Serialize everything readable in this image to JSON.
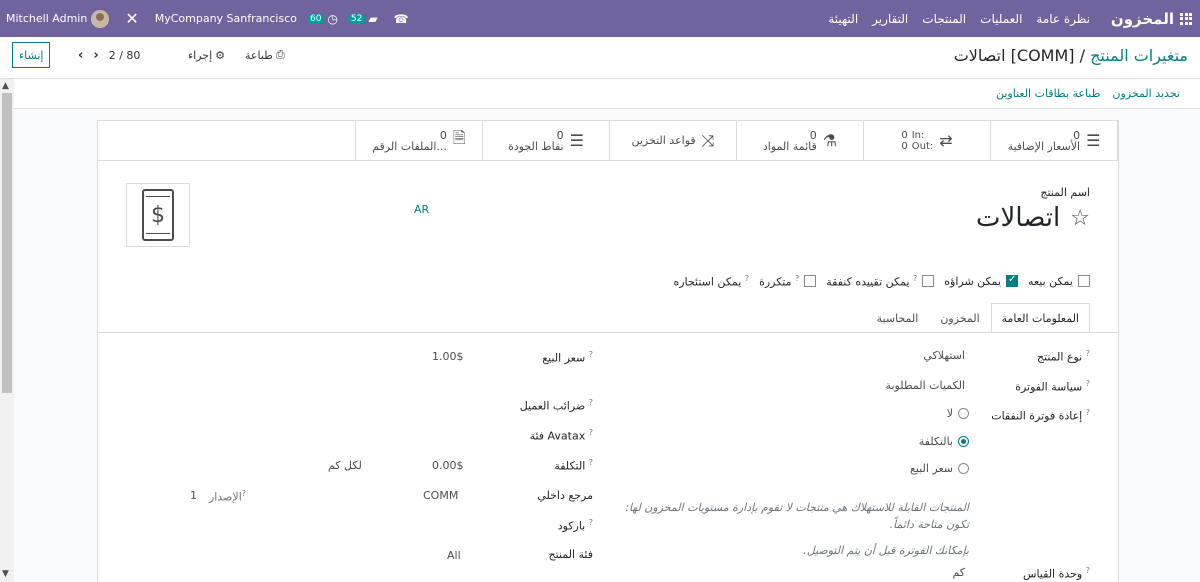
{
  "navbar": {
    "app_name": "المخزون",
    "menu": [
      "نظرة عامة",
      "العمليات",
      "المنتجات",
      "التقارير",
      "التهيئة"
    ],
    "user": "Mitchell Admin",
    "company": "MyCompany Sanfrancisco",
    "activity_count": "60",
    "messages_count": "52"
  },
  "control_panel": {
    "breadcrumb_parent": "متغيرات المنتج",
    "breadcrumb_sep": " / ",
    "breadcrumb_current": "[COMM] اتصالات",
    "create_label": "إنشاء",
    "pager": "2 / 80",
    "print_label": "طباعة",
    "action_label": "إجراء"
  },
  "action_bar": {
    "update_stock": "تجديد المخزون",
    "print_labels": "طباعة بطاقات العناوين"
  },
  "smart_buttons": [
    {
      "count": "0",
      "label": "الأسعار الإضافية",
      "icon": "list-icon"
    },
    {
      "in_label": "In:",
      "in_value": "0",
      "out_label": "Out:",
      "out_value": "0",
      "icon": "exchange-icon"
    },
    {
      "count": "0",
      "label": "قائمة المواد",
      "icon": "flask-icon"
    },
    {
      "label": "قواعد التخزين",
      "icon": "random-icon"
    },
    {
      "count": "0",
      "label": "نقاط الجودة",
      "icon": "list-icon"
    },
    {
      "count": "0",
      "label": "الملفات الرقم...",
      "icon": "file-icon"
    }
  ],
  "product": {
    "name_label": "اسم المنتج",
    "name": "اتصالات",
    "lang": "AR",
    "checkboxes": [
      {
        "label": "يمكن بيعه",
        "checked": false,
        "help": false
      },
      {
        "label": "يمكن شراؤه",
        "checked": true,
        "help": false
      },
      {
        "label": "يمكن تقييده كنفقة",
        "checked": false,
        "help": true
      },
      {
        "label": "متكررة",
        "checked": false,
        "help": true
      },
      {
        "label": "يمكن استئجاره",
        "checked": false,
        "help": true
      }
    ]
  },
  "tabs": [
    "المعلومات العامة",
    "المخزون",
    "المحاسبة"
  ],
  "help_mark": "?",
  "general": {
    "product_type_label": "نوع المنتج",
    "product_type": "استهلاكي",
    "invoicing_policy_label": "سياسة الفوترة",
    "invoicing_policy": "الكميات المطلوبة",
    "reinvoice_label": "إعادة فوترة النفقات",
    "reinvoice_options": [
      "لا",
      "بالتكلفة",
      "سعر البيع"
    ],
    "reinvoice_selected": 1,
    "consumable_note": "المنتجات القابلة للاستهلاك هي منتجات لا تقوم بإدارة مستويات المخزون لها: تكون متاحة دائماً.",
    "invoice_note": "بإمكانك الفوترة قبل أن يتم التوصيل.",
    "uom_label": "وحدة القياس",
    "uom": "كم",
    "sales_price_label": "سعر البيع",
    "sales_price": "1.00$",
    "customer_taxes_label": "ضرائب العميل",
    "avatax_label": "فئة Avatax",
    "cost_label": "التكلفة",
    "cost": "0.00$",
    "cost_per": "لكل كم",
    "internal_ref_label": "مرجع داخلي",
    "internal_ref": "COMM",
    "version_label": "الإصدار",
    "version": "1",
    "barcode_label": "باركود",
    "category_label": "فئة المنتج",
    "category": "All"
  },
  "colors": {
    "navbar": "#71639e",
    "accent": "#017e84"
  }
}
